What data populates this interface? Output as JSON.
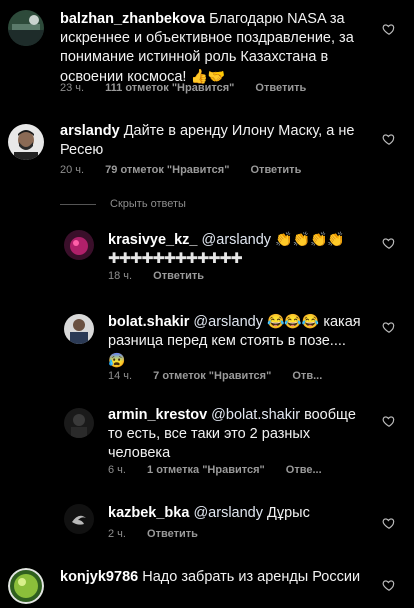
{
  "comments": [
    {
      "username": "balzhan_zhanbekova",
      "text": "Благодарю NASA за искреннее и объективное поздравление, за понимание истинной роль Казахстана в освоении космоса!",
      "emoji": "👍🤝",
      "time": "23 ч.",
      "likes": "111 отметок \"Нравится\"",
      "reply": "Ответить"
    },
    {
      "username": "arslandy",
      "text": "Дайте в аренду Илону Маску, а не Ресею",
      "time": "20 ч.",
      "likes": "79 отметок \"Нравится\"",
      "reply": "Ответить"
    },
    {
      "username": "krasivye_kz_",
      "mention": "@arslandy",
      "emoji": "👏👏👏👏",
      "text": "✚✚✚✚✚✚✚✚✚✚✚✚",
      "time": "18 ч.",
      "reply": "Ответить"
    },
    {
      "username": "bolat.shakir",
      "mention": "@arslandy",
      "emoji": "😂😂😂",
      "text": "какая разница перед кем стоять в позе....",
      "emoji2": "😰",
      "time": "14 ч.",
      "likes": "7 отметок \"Нравится\"",
      "reply": "Отв..."
    },
    {
      "username": "armin_krestov",
      "mention": "@bolat.shakir",
      "text": "вообще то есть, все таки это 2 разных человека",
      "time": "6 ч.",
      "likes": "1 отметка \"Нравится\"",
      "reply": "Отве..."
    },
    {
      "username": "kazbek_bka",
      "mention": "@arslandy",
      "text": "Дұрыс",
      "time": "2 ч.",
      "reply": "Ответить"
    },
    {
      "username": "konjyk9786",
      "text": "Надо забрать из аренды России"
    }
  ],
  "hide_replies": "Скрыть ответы",
  "colors": {
    "background": "#000000",
    "text": "#f2f2f2",
    "meta": "#8e8e8e"
  },
  "icons": {
    "heart": "heart-outline-icon"
  }
}
